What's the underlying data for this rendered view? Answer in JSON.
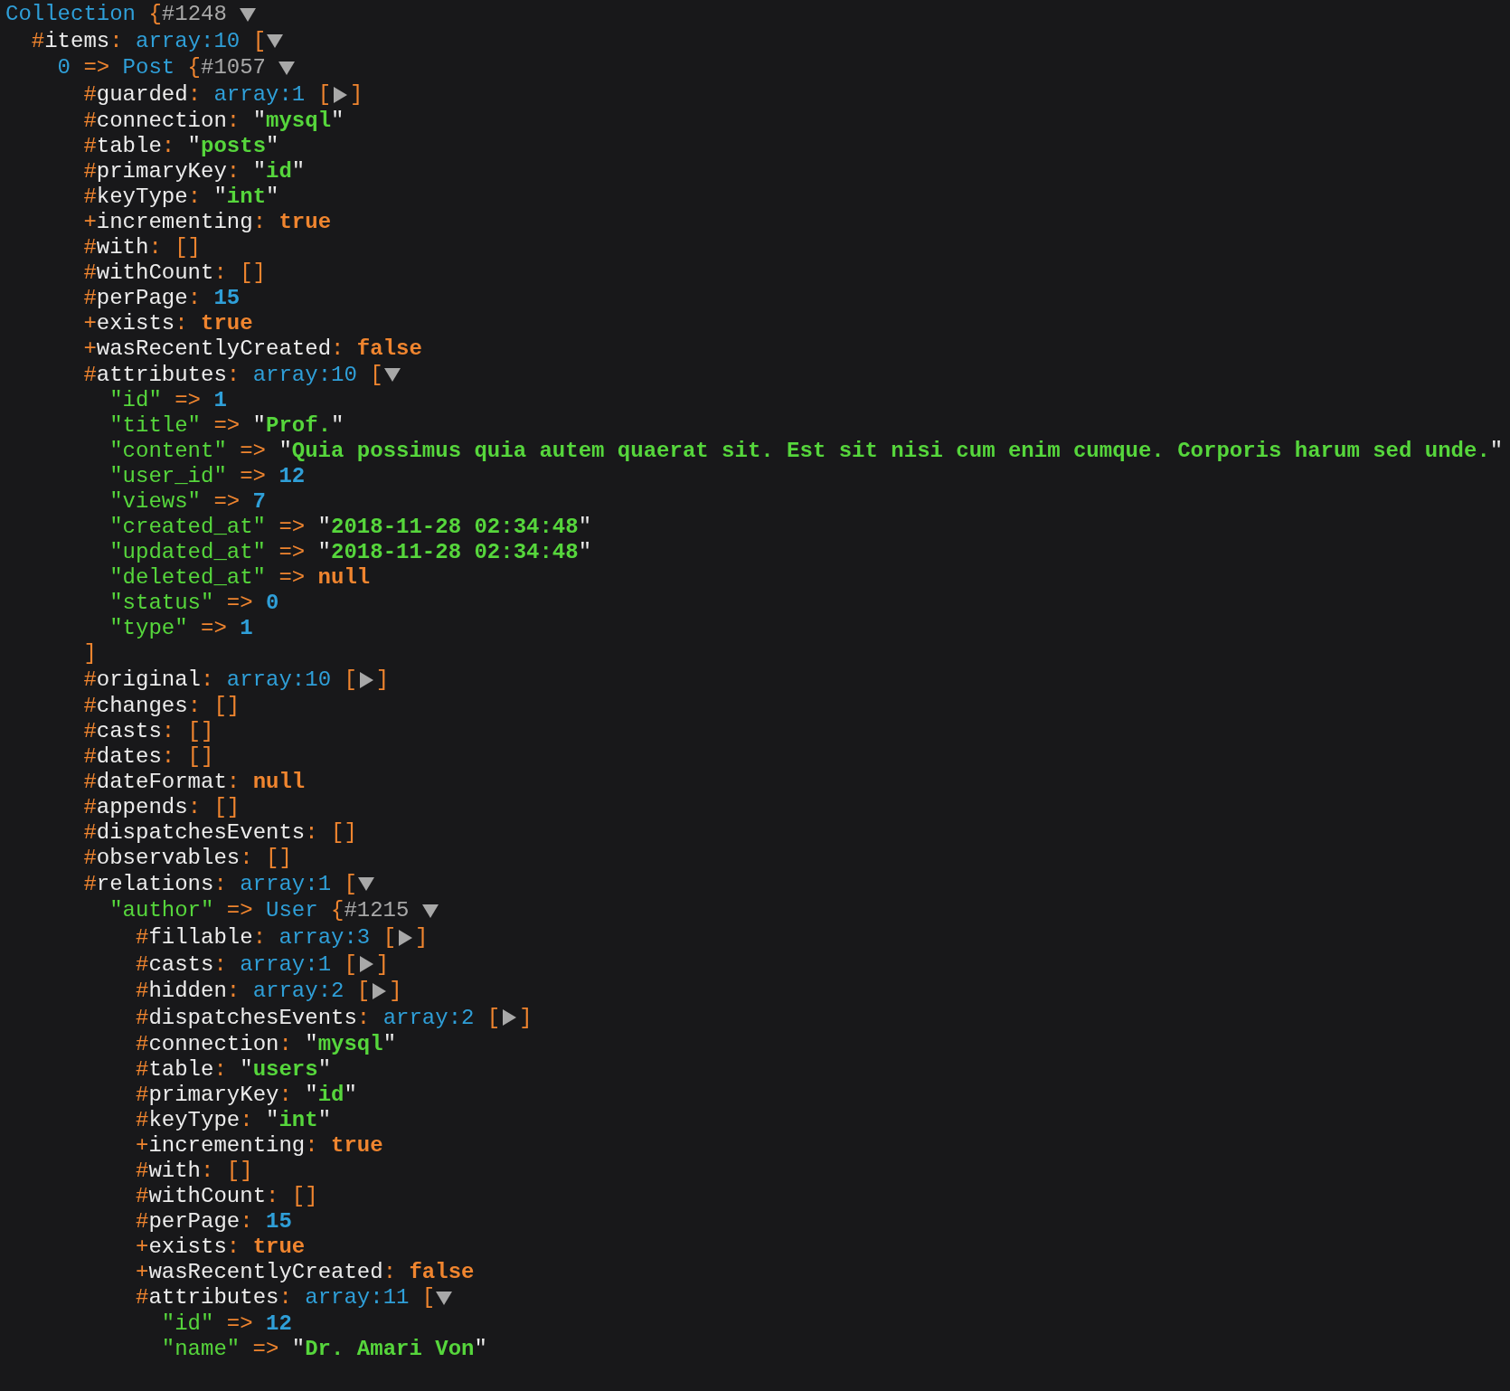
{
  "root": {
    "kind": "object",
    "class": "Collection",
    "open": "{",
    "ref": "#1248",
    "expanded": true,
    "children": [
      {
        "prefix": "#",
        "property": "items",
        "sep": ":",
        "kind": "array",
        "label": "array:10",
        "open": "[",
        "expanded": true,
        "children": [
          {
            "index": "0",
            "sep": "=>",
            "kind": "object",
            "class": "Post",
            "open": "{",
            "ref": "#1057",
            "expanded": true,
            "children": [
              {
                "prefix": "#",
                "property": "guarded",
                "sep": ":",
                "kind": "array",
                "label": "array:1",
                "open": "[",
                "expanded": false,
                "close": "]"
              },
              {
                "prefix": "#",
                "property": "connection",
                "sep": ":",
                "kind": "string",
                "value": "\"**mysql**\""
              },
              {
                "prefix": "#",
                "property": "table",
                "sep": ":",
                "kind": "string",
                "value": "\"**posts**\""
              },
              {
                "prefix": "#",
                "property": "primaryKey",
                "sep": ":",
                "kind": "string",
                "value": "\"**id**\""
              },
              {
                "prefix": "#",
                "property": "keyType",
                "sep": ":",
                "kind": "string",
                "value": "\"**int**\""
              },
              {
                "prefix": "+",
                "property": "incrementing",
                "sep": ":",
                "kind": "constant",
                "value": "true"
              },
              {
                "prefix": "#",
                "property": "with",
                "sep": ":",
                "kind": "empty",
                "value": "[]"
              },
              {
                "prefix": "#",
                "property": "withCount",
                "sep": ":",
                "kind": "empty",
                "value": "[]"
              },
              {
                "prefix": "#",
                "property": "perPage",
                "sep": ":",
                "kind": "number",
                "value": "15"
              },
              {
                "prefix": "+",
                "property": "exists",
                "sep": ":",
                "kind": "constant",
                "value": "true"
              },
              {
                "prefix": "+",
                "property": "wasRecentlyCreated",
                "sep": ":",
                "kind": "constant",
                "value": "false"
              },
              {
                "prefix": "#",
                "property": "attributes",
                "sep": ":",
                "kind": "array",
                "label": "array:10",
                "open": "[",
                "expanded": true,
                "close": "]",
                "children": [
                  {
                    "key": "\"id\"",
                    "sep": "=>",
                    "kind": "number",
                    "value": "1"
                  },
                  {
                    "key": "\"title\"",
                    "sep": "=>",
                    "kind": "string",
                    "value": "\"**Prof.**\""
                  },
                  {
                    "key": "\"content\"",
                    "sep": "=>",
                    "kind": "string",
                    "value": "\"**Quia possimus quia autem quaerat sit. Est sit nisi cum enim cumque. Corporis harum sed unde.**\""
                  },
                  {
                    "key": "\"user_id\"",
                    "sep": "=>",
                    "kind": "number",
                    "value": "12"
                  },
                  {
                    "key": "\"views\"",
                    "sep": "=>",
                    "kind": "number",
                    "value": "7"
                  },
                  {
                    "key": "\"created_at\"",
                    "sep": "=>",
                    "kind": "string",
                    "value": "\"**2018-11-28 02:34:48**\""
                  },
                  {
                    "key": "\"updated_at\"",
                    "sep": "=>",
                    "kind": "string",
                    "value": "\"**2018-11-28 02:34:48**\""
                  },
                  {
                    "key": "\"deleted_at\"",
                    "sep": "=>",
                    "kind": "constant",
                    "value": "null"
                  },
                  {
                    "key": "\"status\"",
                    "sep": "=>",
                    "kind": "number",
                    "value": "0"
                  },
                  {
                    "key": "\"type\"",
                    "sep": "=>",
                    "kind": "number",
                    "value": "1"
                  }
                ]
              },
              {
                "prefix": "#",
                "property": "original",
                "sep": ":",
                "kind": "array",
                "label": "array:10",
                "open": "[",
                "expanded": false,
                "close": "]"
              },
              {
                "prefix": "#",
                "property": "changes",
                "sep": ":",
                "kind": "empty",
                "value": "[]"
              },
              {
                "prefix": "#",
                "property": "casts",
                "sep": ":",
                "kind": "empty",
                "value": "[]"
              },
              {
                "prefix": "#",
                "property": "dates",
                "sep": ":",
                "kind": "empty",
                "value": "[]"
              },
              {
                "prefix": "#",
                "property": "dateFormat",
                "sep": ":",
                "kind": "constant",
                "value": "null"
              },
              {
                "prefix": "#",
                "property": "appends",
                "sep": ":",
                "kind": "empty",
                "value": "[]"
              },
              {
                "prefix": "#",
                "property": "dispatchesEvents",
                "sep": ":",
                "kind": "empty",
                "value": "[]"
              },
              {
                "prefix": "#",
                "property": "observables",
                "sep": ":",
                "kind": "empty",
                "value": "[]"
              },
              {
                "prefix": "#",
                "property": "relations",
                "sep": ":",
                "kind": "array",
                "label": "array:1",
                "open": "[",
                "expanded": true,
                "children": [
                  {
                    "key": "\"author\"",
                    "sep": "=>",
                    "kind": "object",
                    "class": "User",
                    "open": "{",
                    "ref": "#1215",
                    "expanded": true,
                    "children": [
                      {
                        "prefix": "#",
                        "property": "fillable",
                        "sep": ":",
                        "kind": "array",
                        "label": "array:3",
                        "open": "[",
                        "expanded": false,
                        "close": "]"
                      },
                      {
                        "prefix": "#",
                        "property": "casts",
                        "sep": ":",
                        "kind": "array",
                        "label": "array:1",
                        "open": "[",
                        "expanded": false,
                        "close": "]"
                      },
                      {
                        "prefix": "#",
                        "property": "hidden",
                        "sep": ":",
                        "kind": "array",
                        "label": "array:2",
                        "open": "[",
                        "expanded": false,
                        "close": "]"
                      },
                      {
                        "prefix": "#",
                        "property": "dispatchesEvents",
                        "sep": ":",
                        "kind": "array",
                        "label": "array:2",
                        "open": "[",
                        "expanded": false,
                        "close": "]"
                      },
                      {
                        "prefix": "#",
                        "property": "connection",
                        "sep": ":",
                        "kind": "string",
                        "value": "\"**mysql**\""
                      },
                      {
                        "prefix": "#",
                        "property": "table",
                        "sep": ":",
                        "kind": "string",
                        "value": "\"**users**\""
                      },
                      {
                        "prefix": "#",
                        "property": "primaryKey",
                        "sep": ":",
                        "kind": "string",
                        "value": "\"**id**\""
                      },
                      {
                        "prefix": "#",
                        "property": "keyType",
                        "sep": ":",
                        "kind": "string",
                        "value": "\"**int**\""
                      },
                      {
                        "prefix": "+",
                        "property": "incrementing",
                        "sep": ":",
                        "kind": "constant",
                        "value": "true"
                      },
                      {
                        "prefix": "#",
                        "property": "with",
                        "sep": ":",
                        "kind": "empty",
                        "value": "[]"
                      },
                      {
                        "prefix": "#",
                        "property": "withCount",
                        "sep": ":",
                        "kind": "empty",
                        "value": "[]"
                      },
                      {
                        "prefix": "#",
                        "property": "perPage",
                        "sep": ":",
                        "kind": "number",
                        "value": "15"
                      },
                      {
                        "prefix": "+",
                        "property": "exists",
                        "sep": ":",
                        "kind": "constant",
                        "value": "true"
                      },
                      {
                        "prefix": "+",
                        "property": "wasRecentlyCreated",
                        "sep": ":",
                        "kind": "constant",
                        "value": "false"
                      },
                      {
                        "prefix": "#",
                        "property": "attributes",
                        "sep": ":",
                        "kind": "array",
                        "label": "array:11",
                        "open": "[",
                        "expanded": true,
                        "children": [
                          {
                            "key": "\"id\"",
                            "sep": "=>",
                            "kind": "number",
                            "value": "12"
                          },
                          {
                            "key": "\"name\"",
                            "sep": "=>",
                            "kind": "string",
                            "value": "\"**Dr. Amari Von**\""
                          }
                        ]
                      }
                    ]
                  }
                ]
              }
            ]
          }
        ]
      }
    ]
  }
}
